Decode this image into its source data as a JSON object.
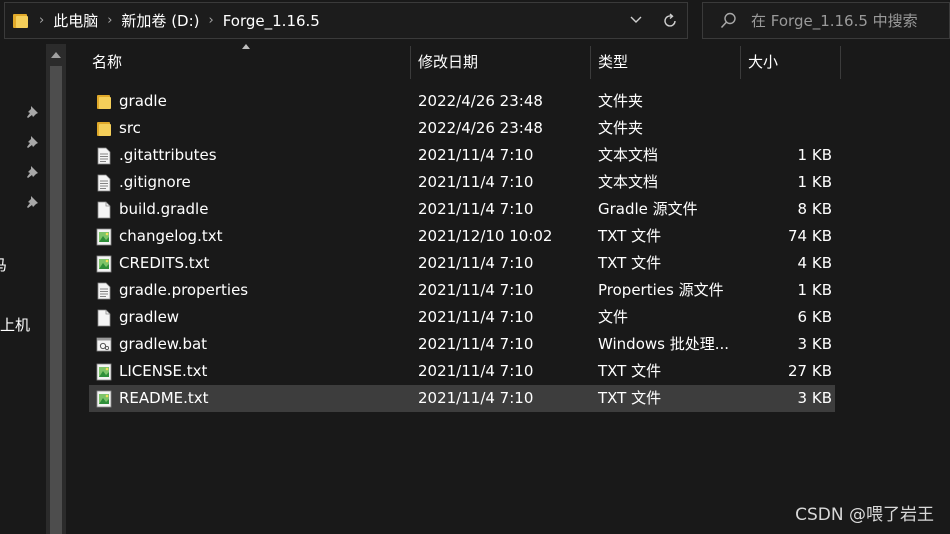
{
  "breadcrumb": {
    "items": [
      "此电脑",
      "新加卷 (D:)",
      "Forge_1.16.5"
    ]
  },
  "search": {
    "placeholder": "在 Forge_1.16.5 中搜索"
  },
  "navpane": {
    "partial_labels": [
      "马",
      "上机"
    ]
  },
  "columns": {
    "name": "名称",
    "date": "修改日期",
    "type": "类型",
    "size": "大小"
  },
  "files": [
    {
      "name": "gradle",
      "date": "2022/4/26 23:48",
      "type": "文件夹",
      "size": "",
      "icon": "folder-icon"
    },
    {
      "name": "src",
      "date": "2022/4/26 23:48",
      "type": "文件夹",
      "size": "",
      "icon": "folder-icon"
    },
    {
      "name": ".gitattributes",
      "date": "2021/11/4 7:10",
      "type": "文本文档",
      "size": "1 KB",
      "icon": "text-file-icon"
    },
    {
      "name": ".gitignore",
      "date": "2021/11/4 7:10",
      "type": "文本文档",
      "size": "1 KB",
      "icon": "text-file-icon"
    },
    {
      "name": "build.gradle",
      "date": "2021/11/4 7:10",
      "type": "Gradle 源文件",
      "size": "8 KB",
      "icon": "file-icon"
    },
    {
      "name": "changelog.txt",
      "date": "2021/12/10 10:02",
      "type": "TXT 文件",
      "size": "74 KB",
      "icon": "txt-image-icon"
    },
    {
      "name": "CREDITS.txt",
      "date": "2021/11/4 7:10",
      "type": "TXT 文件",
      "size": "4 KB",
      "icon": "txt-image-icon"
    },
    {
      "name": "gradle.properties",
      "date": "2021/11/4 7:10",
      "type": "Properties 源文件",
      "size": "1 KB",
      "icon": "text-file-icon"
    },
    {
      "name": "gradlew",
      "date": "2021/11/4 7:10",
      "type": "文件",
      "size": "6 KB",
      "icon": "file-icon"
    },
    {
      "name": "gradlew.bat",
      "date": "2021/11/4 7:10",
      "type": "Windows 批处理...",
      "size": "3 KB",
      "icon": "batch-file-icon"
    },
    {
      "name": "LICENSE.txt",
      "date": "2021/11/4 7:10",
      "type": "TXT 文件",
      "size": "27 KB",
      "icon": "txt-image-icon"
    },
    {
      "name": "README.txt",
      "date": "2021/11/4 7:10",
      "type": "TXT 文件",
      "size": "3 KB",
      "icon": "txt-image-icon",
      "selected": true
    }
  ],
  "watermark": "CSDN @喂了岩王",
  "colors": {
    "background": "#191919",
    "selected_row": "#3d3d3d",
    "folder": "#f5cf5a",
    "text": "#ffffff"
  }
}
